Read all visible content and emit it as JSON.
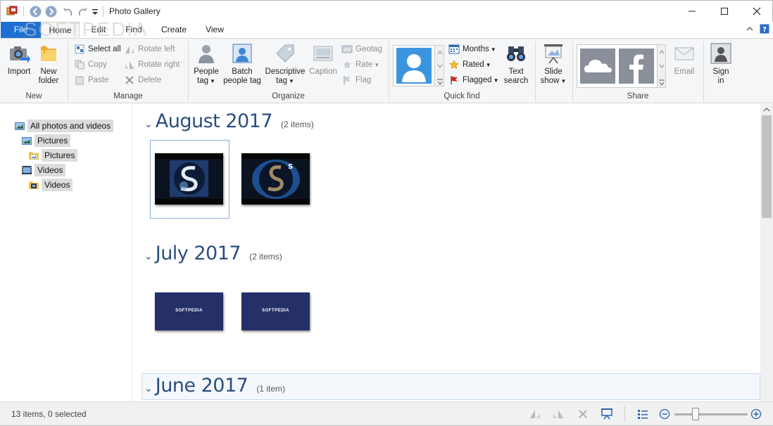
{
  "window": {
    "title": "Photo Gallery"
  },
  "watermark": "SOFTPEDIA",
  "tabs": [
    "File",
    "Home",
    "Edit",
    "Find",
    "Create",
    "View"
  ],
  "ribbon": {
    "new": {
      "label": "New",
      "import": "Import",
      "new_folder_1": "New",
      "new_folder_2": "folder"
    },
    "manage": {
      "label": "Manage",
      "select_all": "Select all",
      "copy": "Copy",
      "paste": "Paste",
      "rotate_left": "Rotate left",
      "rotate_right": "Rotate right",
      "delete": "Delete"
    },
    "organize": {
      "label": "Organize",
      "people_tag_1": "People",
      "people_tag_2": "tag",
      "batch_1": "Batch",
      "batch_2": "people tag",
      "descriptive_1": "Descriptive",
      "descriptive_2": "tag",
      "caption": "Caption",
      "geotag": "Geotag",
      "rate": "Rate",
      "flag": "Flag"
    },
    "quick_find": {
      "label": "Quick find",
      "months": "Months",
      "rated": "Rated",
      "flagged": "Flagged",
      "text_search_1": "Text",
      "text_search_2": "search"
    },
    "slide_show_1": "Slide",
    "slide_show_2": "show",
    "share": {
      "label": "Share",
      "email": "Email",
      "sign_in_1": "Sign",
      "sign_in_2": "in"
    }
  },
  "nav": {
    "items": [
      "All photos and videos",
      "Pictures",
      "Pictures",
      "Videos",
      "Videos"
    ]
  },
  "groups": [
    {
      "month": "August 2017",
      "count": "(2 items)"
    },
    {
      "month": "July 2017",
      "count": "(2 items)"
    },
    {
      "month": "June 2017",
      "count": "(1 item)"
    }
  ],
  "thumbs": {
    "softpedia_label": "SOFTPEDIA"
  },
  "status": {
    "text": "13 items, 0 selected"
  },
  "colors": {
    "accent": "#1e6fd2",
    "month_title": "#2b4f7e",
    "ribbon_bg": "#f5f6f7"
  }
}
